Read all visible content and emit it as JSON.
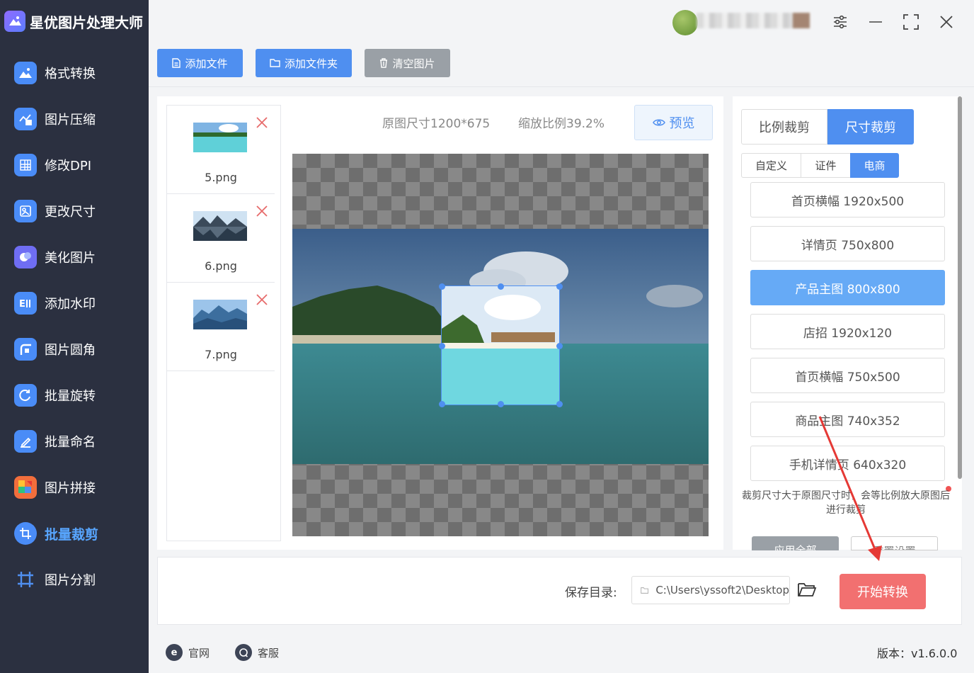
{
  "app": {
    "name": "星优图片处理大师"
  },
  "sidebar": {
    "items": [
      {
        "label": "格式转换",
        "icon": "image-convert-icon",
        "color": "#4a8cf7"
      },
      {
        "label": "图片压缩",
        "icon": "image-compress-icon",
        "color": "#4a8cf7"
      },
      {
        "label": "修改DPI",
        "icon": "dpi-icon",
        "color": "#4a8cf7"
      },
      {
        "label": "更改尺寸",
        "icon": "resize-icon",
        "color": "#4a8cf7"
      },
      {
        "label": "美化图片",
        "icon": "beautify-icon",
        "color": "#6f6df3"
      },
      {
        "label": "添加水印",
        "icon": "watermark-icon",
        "color": "#4a8cf7"
      },
      {
        "label": "图片圆角",
        "icon": "round-corner-icon",
        "color": "#4a8cf7"
      },
      {
        "label": "批量旋转",
        "icon": "rotate-icon",
        "color": "#4a8cf7"
      },
      {
        "label": "批量命名",
        "icon": "rename-icon",
        "color": "#4a8cf7"
      },
      {
        "label": "图片拼接",
        "icon": "puzzle-icon",
        "color": "#f26e3c"
      },
      {
        "label": "批量裁剪",
        "icon": "crop-icon",
        "color": "#4a8cf7"
      },
      {
        "label": "图片分割",
        "icon": "split-icon",
        "color": "#4a8cf7"
      }
    ],
    "active_index": 10
  },
  "toolbar": {
    "add_file": "添加文件",
    "add_folder": "添加文件夹",
    "clear": "清空图片"
  },
  "files": [
    {
      "name": "5.png"
    },
    {
      "name": "6.png"
    },
    {
      "name": "7.png"
    }
  ],
  "preview": {
    "original_size": "原图尺寸1200*675",
    "scale": "缩放比例39.2%",
    "preview_button": "预览"
  },
  "crop": {
    "mode_tabs": [
      "比例裁剪",
      "尺寸裁剪"
    ],
    "active_mode": 1,
    "sub_tabs": [
      "自定义",
      "证件",
      "电商"
    ],
    "active_sub_tab": 2,
    "presets": [
      "首页横幅 1920x500",
      "详情页 750x800",
      "产品主图 800x800",
      "店招 1920x120",
      "首页横幅 750x500",
      "商品主图 740x352",
      "手机详情页 640x320"
    ],
    "active_preset": 2,
    "note": "裁剪尺寸大于原图尺寸时，会等比例放大原图后进行裁剪",
    "apply_all": "应用全部",
    "reset": "重置设置"
  },
  "bottom": {
    "save_label": "保存目录:",
    "save_path": "C:\\Users\\yssoft2\\Desktop",
    "start_button": "开始转换"
  },
  "footer": {
    "website": "官网",
    "support": "客服",
    "version": "版本：v1.6.0.0"
  },
  "colors": {
    "sidebar_bg": "#2b3040",
    "accent": "#4f8ff0",
    "start": "#f27070",
    "arrow": "#e53935"
  }
}
